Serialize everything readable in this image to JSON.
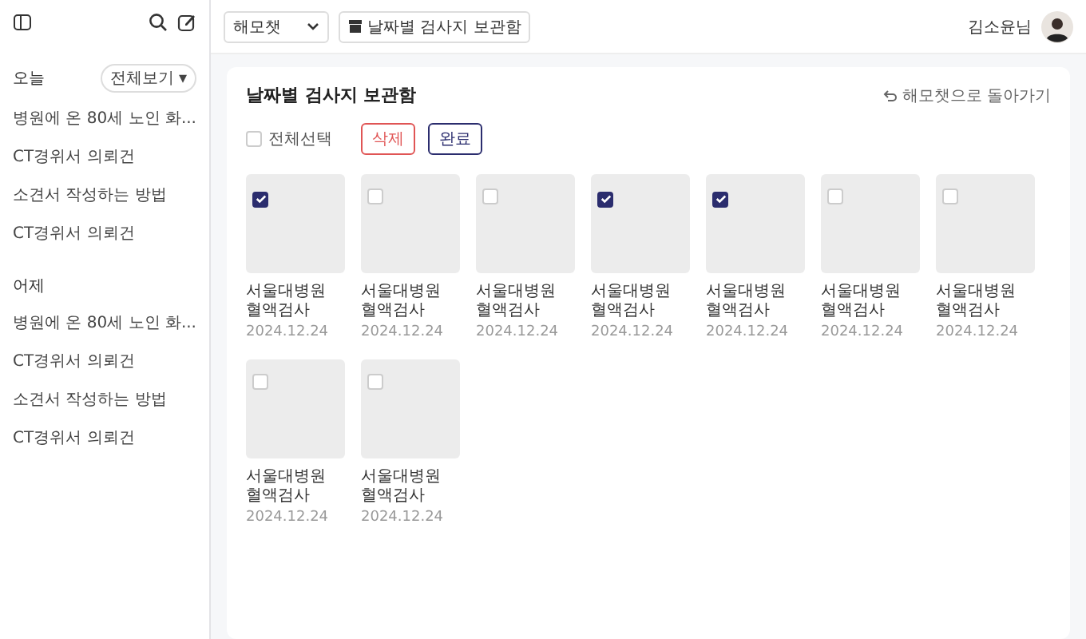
{
  "sidebar": {
    "sections": [
      {
        "title": "오늘",
        "more": "전체보기 ▾",
        "items": [
          "병원에 온 80세 노인 화...",
          "CT경위서 의뢰건",
          "소견서 작성하는 방법",
          "CT경위서 의뢰건"
        ]
      },
      {
        "title": "어제",
        "items": [
          "병원에 온 80세 노인 화...",
          "CT경위서 의뢰건",
          "소견서 작성하는 방법",
          "CT경위서 의뢰건"
        ]
      }
    ]
  },
  "header": {
    "dropdown": "해모챗",
    "archive_button": "날짜별 검사지 보관함",
    "user": "김소윤님"
  },
  "panel": {
    "title": "날짜별 검사지 보관함",
    "back_link": "해모챗으로 돌아가기",
    "select_all": {
      "label": "전체선택",
      "checked": false
    },
    "delete_button": "삭제",
    "done_button": "완료",
    "items": [
      {
        "title": "서울대병원 혈액검사",
        "date": "2024.12.24",
        "checked": true
      },
      {
        "title": "서울대병원 혈액검사",
        "date": "2024.12.24",
        "checked": false
      },
      {
        "title": "서울대병원 혈액검사",
        "date": "2024.12.24",
        "checked": false
      },
      {
        "title": "서울대병원 혈액검사",
        "date": "2024.12.24",
        "checked": true
      },
      {
        "title": "서울대병원 혈액검사",
        "date": "2024.12.24",
        "checked": true
      },
      {
        "title": "서울대병원 혈액검사",
        "date": "2024.12.24",
        "checked": false
      },
      {
        "title": "서울대병원 혈액검사",
        "date": "2024.12.24",
        "checked": false
      },
      {
        "title": "서울대병원 혈액검사",
        "date": "2024.12.24",
        "checked": false
      },
      {
        "title": "서울대병원 혈액검사",
        "date": "2024.12.24",
        "checked": false
      }
    ]
  }
}
